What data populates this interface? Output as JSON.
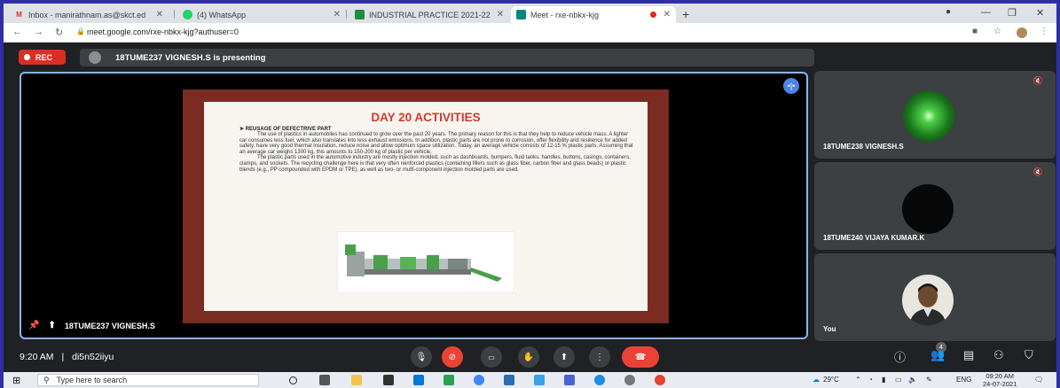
{
  "browser": {
    "tabs": [
      {
        "title": "Inbox - manirathnam.as@skct.ed",
        "icon": "gmail-icon",
        "color": "#d93025"
      },
      {
        "title": "(4) WhatsApp",
        "icon": "whatsapp-icon",
        "color": "#25d366"
      },
      {
        "title": "INDUSTRIAL PRACTICE 2021-22",
        "icon": "classroom-icon",
        "color": "#1e8e3e"
      },
      {
        "title": "Meet - rxe-nbkx-kjg",
        "icon": "meet-icon",
        "color": "#00897b"
      }
    ],
    "url": "meet.google.com/rxe-nbkx-kjg?authuser=0"
  },
  "meet": {
    "rec_label": "REC",
    "presenting_text": "18TUME237 VIGNESH.S is presenting",
    "stage_label": "18TUME237 VIGNESH.S",
    "slide": {
      "title": "DAY 20 ACTIVITIES",
      "subtitle": "➤  REUSAGE OF DEFECTRIVE PART",
      "para1": "The use of plastics in automobiles has continued to grow over the past 20 years. The primary reason for this is that they help to reduce vehicle mass. A lighter car consumes less fuel, which also translates into less exhaust emissions. In addition, plastic parts are not prone to corrosion, offer flexibility and resilience for added safety, have very good thermal insulation, reduce noise and allow optimum space utilization. Today, an average vehicle consists of 12-15 % plastic parts. Assuming that an average car weighs 1300 kg, this amounts to 150-200 kg of plastic per vehicle.",
      "para2": "The plastic parts used in the automotive industry are mostly injection molded, such as dashboards, bumpers, fluid tanks, handles, buttons, casings, containers, clamps, and sockets. The recycling challenge here is that very often reinforced plastics (containing fillers such as glass fiber, carbon fiber and glass beads) or plastic blends (e.g., PP compounded with EPDM or TPE), as well as two- or multi-component injection molded parts are used."
    },
    "participants": [
      {
        "name": "18TUME238 VIGNESH.S"
      },
      {
        "name": "18TUME240 VIJAYA KUMAR.K"
      },
      {
        "name": "You"
      }
    ],
    "time": "9:20 AM",
    "separator": "|",
    "meeting_code": "di5n52iiyu",
    "people_count": "4"
  },
  "taskbar": {
    "search_placeholder": "Type here to search",
    "temperature": "29°C",
    "language": "ENG",
    "time": "09:20 AM",
    "date": "24-07-2021"
  }
}
